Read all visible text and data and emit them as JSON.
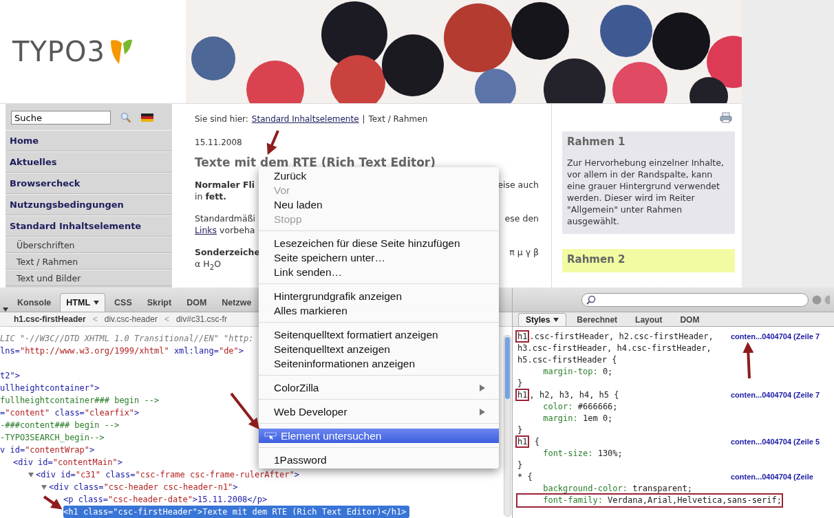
{
  "site": {
    "logo": "TYPO3",
    "search": {
      "value": "Suche"
    },
    "nav": [
      {
        "label": "Home"
      },
      {
        "label": "Aktuelles"
      },
      {
        "label": "Browsercheck"
      },
      {
        "label": "Nutzungsbedingungen"
      },
      {
        "label": "Standard Inhaltselemente",
        "children": [
          {
            "label": "Überschriften"
          },
          {
            "label": "Text / Rahmen"
          },
          {
            "label": "Text und Bilder"
          }
        ]
      }
    ],
    "breadcrumb": [
      {
        "text": "Sie sind hier:",
        "kind": "label"
      },
      {
        "text": "Standard Inhaltselemente",
        "kind": "link"
      },
      {
        "text": "|",
        "kind": "separator"
      },
      {
        "text": "Text / Rahmen",
        "kind": "current"
      }
    ],
    "date": "15.11.2008",
    "heading": "Texte mit dem RTE (Rich Text Editor)",
    "paragraphs": [
      {
        "lines": [
          {
            "left": [
              {
                "text": "Normaler Fli",
                "kind": "bold"
              }
            ],
            "right": [
              {
                "text": "eise auch",
                "kind": "plain"
              }
            ]
          },
          {
            "left": [
              {
                "text": "in **fett.**",
                "kind": "plain"
              }
            ]
          }
        ]
      },
      {
        "lines": [
          {
            "left": [
              {
                "text": "Standardmäßi",
                "kind": "plain"
              }
            ],
            "right": [
              {
                "text": "ese den",
                "kind": "plain"
              }
            ]
          },
          {
            "left": [
              {
                "text": "Links",
                "kind": "link"
              },
              {
                "text": " vorbeha",
                "kind": "plain"
              }
            ]
          }
        ]
      },
      {
        "lines": [
          {
            "left": [
              {
                "text": "Sonderzeiche",
                "kind": "bold"
              }
            ],
            "right": [
              {
                "text": "π µ γ β",
                "kind": "plain"
              }
            ]
          },
          {
            "left": [
              {
                "text": "α H$_{2}$O",
                "kind": "plain"
              }
            ]
          }
        ]
      }
    ],
    "frames": [
      {
        "title": "Rahmen 1",
        "text": "Zur Hervorhebung einzelner Inhalte, vor allem in der Randspalte, kann eine grauer Hintergrund verwendet werden. Dieser wird im Reiter \"Allgemein\" unter Rahmen ausgewählt.",
        "color": "#e6e6ec"
      },
      {
        "title": "Rahmen 2",
        "color": "#f2fba2"
      }
    ]
  },
  "context_menu": {
    "groups": [
      {
        "items": [
          {
            "label": "Zurück",
            "disabled": false,
            "submenu": false,
            "selected": false,
            "icon": false
          },
          {
            "label": "Vor",
            "disabled": true,
            "submenu": false,
            "selected": false,
            "icon": false
          },
          {
            "label": "Neu laden",
            "disabled": false,
            "submenu": false,
            "selected": false,
            "icon": false
          },
          {
            "label": "Stopp",
            "disabled": true,
            "submenu": false,
            "selected": false,
            "icon": false
          }
        ]
      },
      {
        "items": [
          {
            "label": "Lesezeichen für diese Seite hinzufügen",
            "disabled": false,
            "submenu": false,
            "selected": false,
            "icon": false
          },
          {
            "label": "Seite speichern unter…",
            "disabled": false,
            "submenu": false,
            "selected": false,
            "icon": false
          },
          {
            "label": "Link senden…",
            "disabled": false,
            "submenu": false,
            "selected": false,
            "icon": false
          }
        ]
      },
      {
        "items": [
          {
            "label": "Hintergrundgrafik anzeigen",
            "disabled": false,
            "submenu": false,
            "selected": false,
            "icon": false
          },
          {
            "label": "Alles markieren",
            "disabled": false,
            "submenu": false,
            "selected": false,
            "icon": false
          }
        ]
      },
      {
        "items": [
          {
            "label": "Seitenquelltext formatiert anzeigen",
            "disabled": false,
            "submenu": false,
            "selected": false,
            "icon": false
          },
          {
            "label": "Seitenquelltext anzeigen",
            "disabled": false,
            "submenu": false,
            "selected": false,
            "icon": false
          },
          {
            "label": "Seiteninformationen anzeigen",
            "disabled": false,
            "submenu": false,
            "selected": false,
            "icon": false
          }
        ]
      },
      {
        "items": [
          {
            "label": "ColorZilla",
            "disabled": false,
            "submenu": true,
            "selected": false,
            "icon": false
          }
        ]
      },
      {
        "items": [
          {
            "label": "Web Developer",
            "disabled": false,
            "submenu": true,
            "selected": false,
            "icon": false
          }
        ]
      },
      {
        "items": [
          {
            "label": "Element untersuchen",
            "disabled": false,
            "submenu": false,
            "selected": true,
            "icon": true
          }
        ]
      },
      {
        "items": [
          {
            "label": "1Password",
            "disabled": false,
            "submenu": false,
            "selected": false,
            "icon": false
          }
        ]
      }
    ]
  },
  "firebug": {
    "tabs": [
      {
        "label": "Konsole",
        "selected": false,
        "menu": false
      },
      {
        "label": "HTML",
        "selected": true,
        "menu": true
      },
      {
        "label": "CSS",
        "selected": false,
        "menu": false
      },
      {
        "label": "Skript",
        "selected": false,
        "menu": false
      },
      {
        "label": "DOM",
        "selected": false,
        "menu": false
      },
      {
        "label": "Netzwe",
        "selected": false,
        "menu": false
      }
    ],
    "crumbs": [
      {
        "label": "h1.csc-firstHeader",
        "kind": "node",
        "selected": true
      },
      {
        "label": "<",
        "kind": "separator",
        "selected": false
      },
      {
        "label": "div.csc-header",
        "kind": "node",
        "selected": false
      },
      {
        "label": "<",
        "kind": "separator",
        "selected": false
      },
      {
        "label": "div#c31.csc-fr",
        "kind": "node",
        "selected": false
      }
    ],
    "html_tree": [
      {
        "text": "LIC \"-//W3C//DTD XHTML 1.0 Transitional//EN\" \"http:",
        "kind": "doctype",
        "selected": false
      },
      {
        "text": "lns=\"http://www.w3.org/1999/xhtml\" xml:lang=\"de\">",
        "kind": "tag",
        "selected": false
      },
      {
        "kind": "blank",
        "selected": false
      },
      {
        "text": "t2\">",
        "kind": "tag",
        "selected": false
      },
      {
        "text": "ullheightcontainer\">",
        "kind": "tag",
        "selected": false
      },
      {
        "text": "fullheightcontainer### begin -->",
        "kind": "comment",
        "selected": false
      },
      {
        "text": "=\"content\" class=\"clearfix\">",
        "kind": "tag",
        "selected": false
      },
      {
        "text": "-###content### begin -->",
        "kind": "comment",
        "selected": false
      },
      {
        "text": "-TYPO3SEARCH_begin-->",
        "kind": "comment",
        "selected": false
      },
      {
        "text": "v id=\"contentWrap\">",
        "kind": "tag",
        "selected": false,
        "children": [
          {
            "text": "<div id=\"contentMain\">",
            "kind": "tag",
            "selected": false,
            "children": [
              {
                "text": "<div id=\"c31\" class=\"csc-frame csc-frame-rulerAfter\">",
                "kind": "tag",
                "selected": false,
                "expanded": true,
                "children": [
                  {
                    "text": "<div class=\"csc-header csc-header-n1\">",
                    "kind": "tag",
                    "selected": false,
                    "expanded": true,
                    "children": [
                      {
                        "text": "<p class=\"csc-header-date\">15.11.2008</p>",
                        "kind": "tag",
                        "selected": false
                      },
                      {
                        "text": "<h1 class=\"csc-firstHeader\">Texte mit dem RTE (Rich Text Editor)</h1>",
                        "kind": "tag",
                        "selected": true
                      }
                    ]
                  }
                ]
              }
            ]
          }
        ]
      }
    ],
    "side_tabs": [
      {
        "label": "Styles",
        "selected": true,
        "menu": true
      },
      {
        "label": "Berechnet",
        "selected": false,
        "menu": false
      },
      {
        "label": "Layout",
        "selected": false,
        "menu": false
      },
      {
        "label": "DOM",
        "selected": false,
        "menu": false
      }
    ],
    "rules": [
      {
        "head": "h1",
        "head_boxed": true,
        "selector": [
          ".csc-firstHeader, h2.csc-firstHeader,",
          "h3.csc-firstHeader, h4.csc-firstHeader,",
          "h5.csc-firstHeader {"
        ],
        "declarations": [
          {
            "text": "margin-top: 0;",
            "boxed": false
          }
        ],
        "closing": "}",
        "source": "conten...0404704 (Zeile 7"
      },
      {
        "head": "h1",
        "head_boxed": true,
        "selector": [
          ", h2, h3, h4, h5 {"
        ],
        "declarations": [
          {
            "text": "color: #666666;",
            "boxed": false
          },
          {
            "text": "margin: 1em 0;",
            "boxed": false
          }
        ],
        "closing": "}",
        "source": "conten...0404704 (Zeile 7"
      },
      {
        "head": "h1",
        "head_boxed": true,
        "selector": [
          " {"
        ],
        "declarations": [
          {
            "text": "font-size: 130%;",
            "boxed": false
          }
        ],
        "closing": "}",
        "source": "conten...0404704 (Zeile 5"
      },
      {
        "head": "*",
        "head_boxed": false,
        "selector": [
          " {"
        ],
        "declarations": [
          {
            "text": "background-color: transparent;",
            "boxed": false
          },
          {
            "text": "font-family: Verdana,Arial,Helvetica,sans-serif;",
            "boxed": true
          }
        ],
        "source": "conten...0404704 (Zeile"
      }
    ]
  }
}
